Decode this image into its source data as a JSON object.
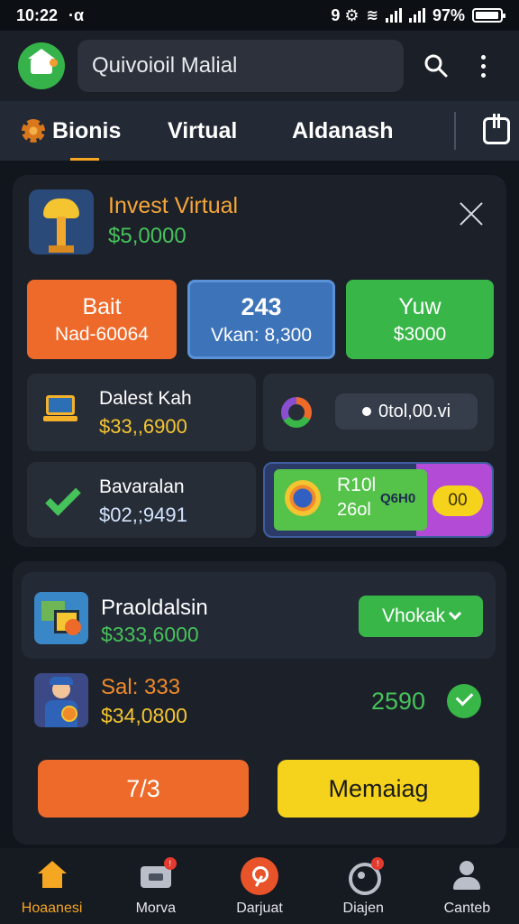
{
  "status_bar": {
    "time": "10:22",
    "carrier_glyph": "·α",
    "glyphs": "9 ⚙",
    "battery": "97%",
    "battery_level": 0.97
  },
  "header": {
    "search_text": "Quivoioil Malial",
    "icons": [
      "app-logo",
      "search-icon",
      "more-vertical-icon"
    ]
  },
  "tabs": [
    {
      "label": "Bionis",
      "active": true
    },
    {
      "label": "Virtual",
      "active": false
    },
    {
      "label": "Aldanash",
      "active": false
    }
  ],
  "invest_card": {
    "title": "Invest Virtual",
    "amount": "$5,0000",
    "stats": [
      {
        "top": "Bait",
        "bottom": "Nad-60064",
        "color": "#ee6a2a"
      },
      {
        "top": "243",
        "bottom": "Vkan: 8,300",
        "color": "#3d73b8"
      },
      {
        "top": "Yuw",
        "bottom": "$3000",
        "color": "#38b648"
      }
    ],
    "tiles": [
      {
        "label": "Dalest Kah",
        "value": "$33,,6900"
      },
      {
        "pill": "0tol,00.vi"
      },
      {
        "label": "Bavaralan",
        "value": "$02,;9491"
      },
      {
        "promo_line1": "R10l",
        "promo_line2": "26ol",
        "promo_tag": "Q6H0",
        "promo_chip": "00"
      }
    ]
  },
  "lower_card": {
    "title": "Praoldalsin",
    "amount": "$333,6000",
    "dropdown": "Vhokak",
    "sal_title": "Sal: 333",
    "sal_amount": "$34,0800",
    "score": "2590",
    "button_left": "7/3",
    "button_right": "Memaiag"
  },
  "bottom_nav": [
    {
      "label": "Hoaanesi",
      "icon": "home-icon",
      "active": true
    },
    {
      "label": "Morva",
      "icon": "tv-icon",
      "badge": "!"
    },
    {
      "label": "Darjuat",
      "icon": "center-action-icon"
    },
    {
      "label": "Diajen",
      "icon": "camera-icon",
      "badge": "!"
    },
    {
      "label": "Canteb",
      "icon": "user-icon"
    }
  ],
  "colors": {
    "background": "#11151c",
    "card": "#1c2129",
    "accent_orange": "#ee6a2a",
    "accent_green": "#38b648",
    "accent_yellow": "#f5d31c",
    "accent_blue": "#3d73b8"
  }
}
